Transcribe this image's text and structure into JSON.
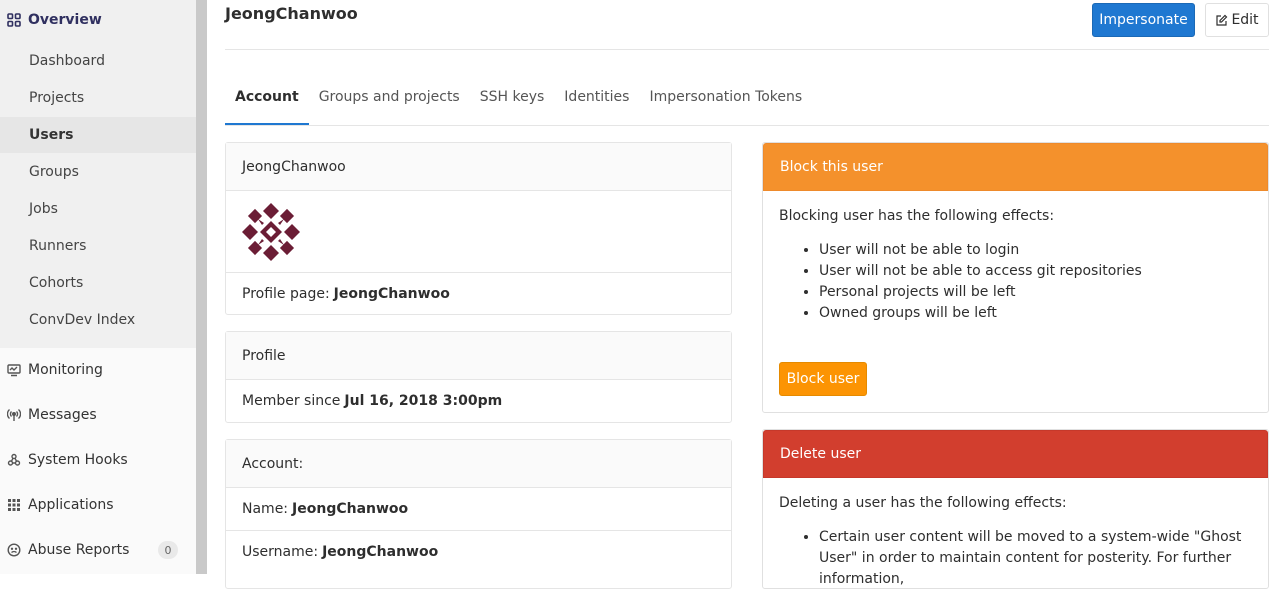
{
  "sidebar": {
    "overview": "Overview",
    "sub_items": [
      "Dashboard",
      "Projects",
      "Users",
      "Groups",
      "Jobs",
      "Runners",
      "Cohorts",
      "ConvDev Index"
    ],
    "main_items": [
      {
        "label": "Monitoring",
        "icon": "monitor-icon"
      },
      {
        "label": "Messages",
        "icon": "broadcast-icon"
      },
      {
        "label": "System Hooks",
        "icon": "hook-icon"
      },
      {
        "label": "Applications",
        "icon": "grid-icon"
      },
      {
        "label": "Abuse Reports",
        "icon": "smiley-icon",
        "badge": "0"
      }
    ]
  },
  "header": {
    "title": "JeongChanwoo",
    "impersonate": "Impersonate",
    "edit": "Edit"
  },
  "tabs": [
    "Account",
    "Groups and projects",
    "SSH keys",
    "Identities",
    "Impersonation Tokens"
  ],
  "user_card": {
    "name": "JeongChanwoo",
    "profile_label": "Profile page:",
    "profile_value": "JeongChanwoo"
  },
  "profile_card": {
    "header": "Profile",
    "member_label": "Member since",
    "member_value": "Jul 16, 2018 3:00pm"
  },
  "account_card": {
    "header": "Account:",
    "name_label": "Name:",
    "name_value": "JeongChanwoo",
    "username_label": "Username:",
    "username_value": "JeongChanwoo"
  },
  "block": {
    "header": "Block this user",
    "intro": "Blocking user has the following effects:",
    "effects": [
      "User will not be able to login",
      "User will not be able to access git repositories",
      "Personal projects will be left",
      "Owned groups will be left"
    ],
    "button": "Block user"
  },
  "delete": {
    "header": "Delete user",
    "intro": "Deleting a user has the following effects:",
    "effect_1": "Certain user content will be moved to a system-wide \"Ghost User\" in order to maintain content for posterity. For further information,"
  }
}
